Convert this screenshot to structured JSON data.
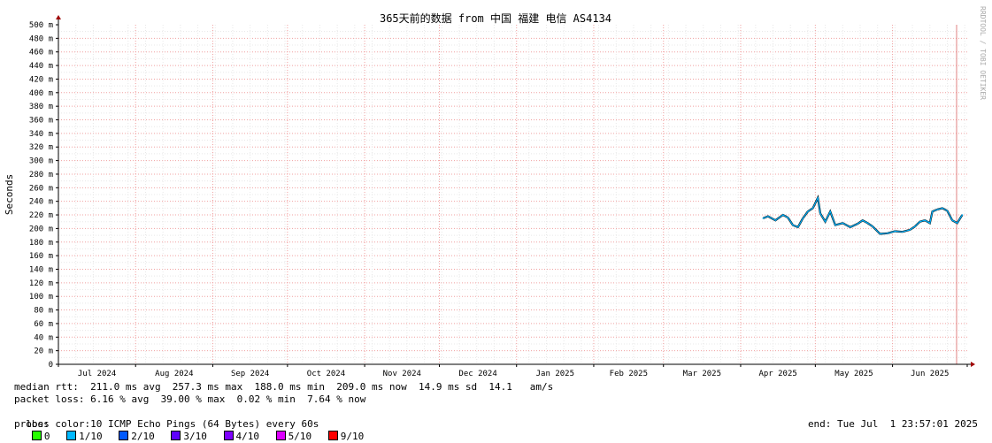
{
  "chart_data": {
    "type": "line",
    "title": "365天前的数据 from 中国 福建 电信 AS4134",
    "ylabel": "Seconds",
    "xlabel": "",
    "ylim": [
      0,
      500
    ],
    "y_ticks": [
      "0",
      "20 m",
      "40 m",
      "60 m",
      "80 m",
      "100 m",
      "120 m",
      "140 m",
      "160 m",
      "180 m",
      "200 m",
      "220 m",
      "240 m",
      "260 m",
      "280 m",
      "300 m",
      "320 m",
      "340 m",
      "360 m",
      "380 m",
      "400 m",
      "420 m",
      "440 m",
      "460 m",
      "480 m",
      "500 m"
    ],
    "x_ticks": [
      "Jul 2024",
      "Aug 2024",
      "Sep 2024",
      "Oct 2024",
      "Nov 2024",
      "Dec 2024",
      "Jan 2025",
      "Feb 2025",
      "Mar 2025",
      "Apr 2025",
      "May 2025",
      "Jun 2025"
    ],
    "x_range": [
      "2024-07-01",
      "2025-07-01"
    ],
    "grid": true,
    "watermark": "RRDTOOL / TOBI OETIKER",
    "series": [
      {
        "color": "#00b4ff",
        "points": [
          [
            "2025-04-10",
            215
          ],
          [
            "2025-04-12",
            218
          ],
          [
            "2025-04-15",
            212
          ],
          [
            "2025-04-18",
            220
          ],
          [
            "2025-04-20",
            216
          ],
          [
            "2025-04-22",
            205
          ],
          [
            "2025-04-24",
            202
          ],
          [
            "2025-04-26",
            215
          ],
          [
            "2025-04-28",
            225
          ],
          [
            "2025-04-30",
            230
          ],
          [
            "2025-05-02",
            245
          ],
          [
            "2025-05-03",
            222
          ],
          [
            "2025-05-05",
            210
          ],
          [
            "2025-05-07",
            225
          ],
          [
            "2025-05-09",
            205
          ],
          [
            "2025-05-12",
            208
          ],
          [
            "2025-05-15",
            202
          ],
          [
            "2025-05-18",
            207
          ],
          [
            "2025-05-20",
            212
          ],
          [
            "2025-05-22",
            208
          ],
          [
            "2025-05-24",
            203
          ],
          [
            "2025-05-27",
            192
          ],
          [
            "2025-05-30",
            193
          ],
          [
            "2025-06-02",
            196
          ],
          [
            "2025-06-05",
            195
          ],
          [
            "2025-06-08",
            198
          ],
          [
            "2025-06-10",
            203
          ],
          [
            "2025-06-12",
            210
          ],
          [
            "2025-06-14",
            212
          ],
          [
            "2025-06-16",
            208
          ],
          [
            "2025-06-17",
            225
          ],
          [
            "2025-06-19",
            228
          ],
          [
            "2025-06-21",
            230
          ],
          [
            "2025-06-23",
            226
          ],
          [
            "2025-06-25",
            212
          ],
          [
            "2025-06-27",
            208
          ],
          [
            "2025-06-29",
            220
          ]
        ]
      }
    ]
  },
  "stats": {
    "median_rtt": "median rtt:  211.0 ms avg  257.3 ms max  188.0 ms min  209.0 ms now  14.9 ms sd  14.1   am/s",
    "packet_loss": "packet loss: 6.16 % avg  39.00 % max  0.02 % min  7.64 % now",
    "loss_color_label": "loss color:",
    "loss_colors": [
      {
        "label": "0",
        "color": "#26ff00"
      },
      {
        "label": "1/10",
        "color": "#00b8ff"
      },
      {
        "label": "2/10",
        "color": "#0059ff"
      },
      {
        "label": "3/10",
        "color": "#5e00ff"
      },
      {
        "label": "4/10",
        "color": "#7e00ff"
      },
      {
        "label": "5/10",
        "color": "#dd00ff"
      },
      {
        "label": "9/10",
        "color": "#ff0000"
      }
    ],
    "probe": "probe:       10 ICMP Echo Pings (64 Bytes) every 60s",
    "end": "end: Tue Jul  1 23:57:01 2025"
  }
}
